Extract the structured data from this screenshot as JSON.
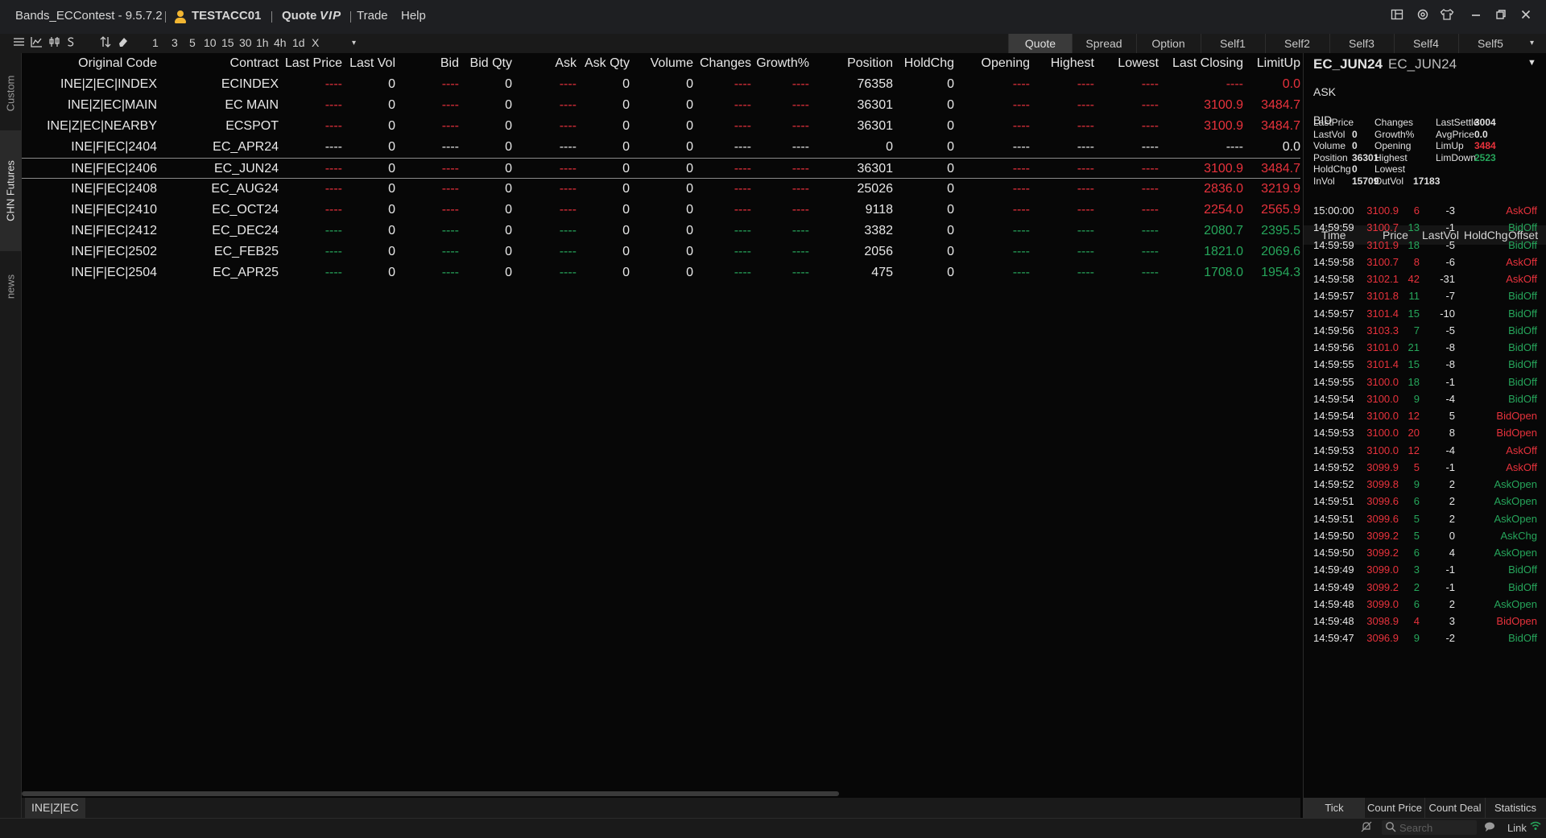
{
  "colors": {
    "up": "#e8323c",
    "down": "#26a65b",
    "accent": "#f2b632"
  },
  "titlebar": {
    "app_title": "Bands_ECContest - 9.5.7.2",
    "username": "TESTACC01",
    "menu": [
      "Quote",
      "VIP",
      "Trade",
      "Help"
    ]
  },
  "toolbar": {
    "periods": [
      "1",
      "3",
      "5",
      "10",
      "15",
      "30",
      "1h",
      "4h",
      "1d",
      "X"
    ],
    "tabs": [
      "Quote",
      "Spread",
      "Option",
      "Self1",
      "Self2",
      "Self3",
      "Self4",
      "Self5"
    ],
    "active_tab": "Quote"
  },
  "sidebar": {
    "tabs": [
      "Custom",
      "CHN Futures",
      "news"
    ],
    "active": "CHN Futures"
  },
  "table": {
    "columns": [
      "Original Code",
      "Contract",
      "Last Price",
      "Last Vol",
      "Bid",
      "Bid Qty",
      "Ask",
      "Ask Qty",
      "Volume",
      "Changes",
      "Growth%",
      "Position",
      "HoldChg",
      "Opening",
      "Highest",
      "Lowest",
      "Last Closing",
      "LimitUp"
    ],
    "rows": [
      {
        "code": "INE|Z|EC|INDEX",
        "contract": "ECINDEX",
        "last_price": "----",
        "last_vol": "0",
        "bid": "----",
        "bid_qty": "0",
        "ask": "----",
        "ask_qty": "0",
        "volume": "0",
        "changes": "----",
        "growth": "----",
        "position": "76358",
        "holdchg": "0",
        "opening": "----",
        "highest": "----",
        "lowest": "----",
        "last_closing": "----",
        "limitup": "0.0",
        "color": "red"
      },
      {
        "code": "INE|Z|EC|MAIN",
        "contract": "EC MAIN",
        "last_price": "----",
        "last_vol": "0",
        "bid": "----",
        "bid_qty": "0",
        "ask": "----",
        "ask_qty": "0",
        "volume": "0",
        "changes": "----",
        "growth": "----",
        "position": "36301",
        "holdchg": "0",
        "opening": "----",
        "highest": "----",
        "lowest": "----",
        "last_closing": "3100.9",
        "limitup": "3484.7",
        "color": "red"
      },
      {
        "code": "INE|Z|EC|NEARBY",
        "contract": "ECSPOT",
        "last_price": "----",
        "last_vol": "0",
        "bid": "----",
        "bid_qty": "0",
        "ask": "----",
        "ask_qty": "0",
        "volume": "0",
        "changes": "----",
        "growth": "----",
        "position": "36301",
        "holdchg": "0",
        "opening": "----",
        "highest": "----",
        "lowest": "----",
        "last_closing": "3100.9",
        "limitup": "3484.7",
        "color": "red"
      },
      {
        "code": "INE|F|EC|2404",
        "contract": "EC_APR24",
        "last_price": "----",
        "last_vol": "0",
        "bid": "----",
        "bid_qty": "0",
        "ask": "----",
        "ask_qty": "0",
        "volume": "0",
        "changes": "----",
        "growth": "----",
        "position": "0",
        "holdchg": "0",
        "opening": "----",
        "highest": "----",
        "lowest": "----",
        "last_closing": "----",
        "limitup": "0.0",
        "color": "white"
      },
      {
        "code": "INE|F|EC|2406",
        "contract": "EC_JUN24",
        "last_price": "----",
        "last_vol": "0",
        "bid": "----",
        "bid_qty": "0",
        "ask": "----",
        "ask_qty": "0",
        "volume": "0",
        "changes": "----",
        "growth": "----",
        "position": "36301",
        "holdchg": "0",
        "opening": "----",
        "highest": "----",
        "lowest": "----",
        "last_closing": "3100.9",
        "limitup": "3484.7",
        "color": "red",
        "selected": true
      },
      {
        "code": "INE|F|EC|2408",
        "contract": "EC_AUG24",
        "last_price": "----",
        "last_vol": "0",
        "bid": "----",
        "bid_qty": "0",
        "ask": "----",
        "ask_qty": "0",
        "volume": "0",
        "changes": "----",
        "growth": "----",
        "position": "25026",
        "holdchg": "0",
        "opening": "----",
        "highest": "----",
        "lowest": "----",
        "last_closing": "2836.0",
        "limitup": "3219.9",
        "color": "red"
      },
      {
        "code": "INE|F|EC|2410",
        "contract": "EC_OCT24",
        "last_price": "----",
        "last_vol": "0",
        "bid": "----",
        "bid_qty": "0",
        "ask": "----",
        "ask_qty": "0",
        "volume": "0",
        "changes": "----",
        "growth": "----",
        "position": "9118",
        "holdchg": "0",
        "opening": "----",
        "highest": "----",
        "lowest": "----",
        "last_closing": "2254.0",
        "limitup": "2565.9",
        "color": "red"
      },
      {
        "code": "INE|F|EC|2412",
        "contract": "EC_DEC24",
        "last_price": "----",
        "last_vol": "0",
        "bid": "----",
        "bid_qty": "0",
        "ask": "----",
        "ask_qty": "0",
        "volume": "0",
        "changes": "----",
        "growth": "----",
        "position": "3382",
        "holdchg": "0",
        "opening": "----",
        "highest": "----",
        "lowest": "----",
        "last_closing": "2080.7",
        "limitup": "2395.5",
        "color": "green"
      },
      {
        "code": "INE|F|EC|2502",
        "contract": "EC_FEB25",
        "last_price": "----",
        "last_vol": "0",
        "bid": "----",
        "bid_qty": "0",
        "ask": "----",
        "ask_qty": "0",
        "volume": "0",
        "changes": "----",
        "growth": "----",
        "position": "2056",
        "holdchg": "0",
        "opening": "----",
        "highest": "----",
        "lowest": "----",
        "last_closing": "1821.0",
        "limitup": "2069.6",
        "color": "green"
      },
      {
        "code": "INE|F|EC|2504",
        "contract": "EC_APR25",
        "last_price": "----",
        "last_vol": "0",
        "bid": "----",
        "bid_qty": "0",
        "ask": "----",
        "ask_qty": "0",
        "volume": "0",
        "changes": "----",
        "growth": "----",
        "position": "475",
        "holdchg": "0",
        "opening": "----",
        "highest": "----",
        "lowest": "----",
        "last_closing": "1708.0",
        "limitup": "1954.3",
        "color": "green"
      }
    ]
  },
  "bottom_tab": "INE|Z|EC",
  "detail": {
    "contract": "EC_JUN24",
    "contract_name": "EC_JUN24",
    "ask_label": "ASK",
    "bid_label": "BID",
    "stats": {
      "col1": [
        [
          "LastPrice",
          ""
        ],
        [
          "LastVol",
          "0"
        ],
        [
          "Volume",
          "0"
        ],
        [
          "Position",
          "36301"
        ],
        [
          "HoldChg",
          "0"
        ],
        [
          "InVol",
          "15709"
        ]
      ],
      "col2": [
        [
          "Changes",
          ""
        ],
        [
          "Growth%",
          ""
        ],
        [
          "Opening",
          ""
        ],
        [
          "Highest",
          ""
        ],
        [
          "Lowest",
          ""
        ],
        [
          "OutVol",
          "17183"
        ]
      ],
      "col3": [
        [
          "LastSettle",
          "3004"
        ],
        [
          "AvgPrice",
          "0.0"
        ],
        [
          "LimUp",
          "3484"
        ],
        [
          "LimDown",
          "2523"
        ]
      ]
    },
    "tick_columns": [
      "Time",
      "Price",
      "LastVol",
      "HoldChg",
      "Offset"
    ],
    "ticks": [
      {
        "time": "15:00:00",
        "price": "3100.9",
        "vol": "6",
        "hold": "-3",
        "offset": "AskOff",
        "pc": "red",
        "vc": "red",
        "oc": "red"
      },
      {
        "time": "14:59:59",
        "price": "3100.7",
        "vol": "13",
        "hold": "-1",
        "offset": "BidOff",
        "pc": "red",
        "vc": "green",
        "oc": "green"
      },
      {
        "time": "14:59:59",
        "price": "3101.9",
        "vol": "18",
        "hold": "-5",
        "offset": "BidOff",
        "pc": "red",
        "vc": "green",
        "oc": "green"
      },
      {
        "time": "14:59:58",
        "price": "3100.7",
        "vol": "8",
        "hold": "-6",
        "offset": "AskOff",
        "pc": "red",
        "vc": "red",
        "oc": "red"
      },
      {
        "time": "14:59:58",
        "price": "3102.1",
        "vol": "42",
        "hold": "-31",
        "offset": "AskOff",
        "pc": "red",
        "vc": "red",
        "oc": "red"
      },
      {
        "time": "14:59:57",
        "price": "3101.8",
        "vol": "11",
        "hold": "-7",
        "offset": "BidOff",
        "pc": "red",
        "vc": "green",
        "oc": "green"
      },
      {
        "time": "14:59:57",
        "price": "3101.4",
        "vol": "15",
        "hold": "-10",
        "offset": "BidOff",
        "pc": "red",
        "vc": "green",
        "oc": "green"
      },
      {
        "time": "14:59:56",
        "price": "3103.3",
        "vol": "7",
        "hold": "-5",
        "offset": "BidOff",
        "pc": "red",
        "vc": "green",
        "oc": "green"
      },
      {
        "time": "14:59:56",
        "price": "3101.0",
        "vol": "21",
        "hold": "-8",
        "offset": "BidOff",
        "pc": "red",
        "vc": "green",
        "oc": "green"
      },
      {
        "time": "14:59:55",
        "price": "3101.4",
        "vol": "15",
        "hold": "-8",
        "offset": "BidOff",
        "pc": "red",
        "vc": "green",
        "oc": "green"
      },
      {
        "time": "14:59:55",
        "price": "3100.0",
        "vol": "18",
        "hold": "-1",
        "offset": "BidOff",
        "pc": "red",
        "vc": "green",
        "oc": "green"
      },
      {
        "time": "14:59:54",
        "price": "3100.0",
        "vol": "9",
        "hold": "-4",
        "offset": "BidOff",
        "pc": "red",
        "vc": "green",
        "oc": "green"
      },
      {
        "time": "14:59:54",
        "price": "3100.0",
        "vol": "12",
        "hold": "5",
        "offset": "BidOpen",
        "pc": "red",
        "vc": "red",
        "oc": "red"
      },
      {
        "time": "14:59:53",
        "price": "3100.0",
        "vol": "20",
        "hold": "8",
        "offset": "BidOpen",
        "pc": "red",
        "vc": "red",
        "oc": "red"
      },
      {
        "time": "14:59:53",
        "price": "3100.0",
        "vol": "12",
        "hold": "-4",
        "offset": "AskOff",
        "pc": "red",
        "vc": "red",
        "oc": "red"
      },
      {
        "time": "14:59:52",
        "price": "3099.9",
        "vol": "5",
        "hold": "-1",
        "offset": "AskOff",
        "pc": "red",
        "vc": "red",
        "oc": "red"
      },
      {
        "time": "14:59:52",
        "price": "3099.8",
        "vol": "9",
        "hold": "2",
        "offset": "AskOpen",
        "pc": "red",
        "vc": "green",
        "oc": "green"
      },
      {
        "time": "14:59:51",
        "price": "3099.6",
        "vol": "6",
        "hold": "2",
        "offset": "AskOpen",
        "pc": "red",
        "vc": "green",
        "oc": "green"
      },
      {
        "time": "14:59:51",
        "price": "3099.6",
        "vol": "5",
        "hold": "2",
        "offset": "AskOpen",
        "pc": "red",
        "vc": "green",
        "oc": "green"
      },
      {
        "time": "14:59:50",
        "price": "3099.2",
        "vol": "5",
        "hold": "0",
        "offset": "AskChg",
        "pc": "red",
        "vc": "green",
        "oc": "green"
      },
      {
        "time": "14:59:50",
        "price": "3099.2",
        "vol": "6",
        "hold": "4",
        "offset": "AskOpen",
        "pc": "red",
        "vc": "green",
        "oc": "green"
      },
      {
        "time": "14:59:49",
        "price": "3099.0",
        "vol": "3",
        "hold": "-1",
        "offset": "BidOff",
        "pc": "red",
        "vc": "green",
        "oc": "green"
      },
      {
        "time": "14:59:49",
        "price": "3099.2",
        "vol": "2",
        "hold": "-1",
        "offset": "BidOff",
        "pc": "red",
        "vc": "green",
        "oc": "green"
      },
      {
        "time": "14:59:48",
        "price": "3099.0",
        "vol": "6",
        "hold": "2",
        "offset": "AskOpen",
        "pc": "red",
        "vc": "green",
        "oc": "green"
      },
      {
        "time": "14:59:48",
        "price": "3098.9",
        "vol": "4",
        "hold": "3",
        "offset": "BidOpen",
        "pc": "red",
        "vc": "red",
        "oc": "red"
      },
      {
        "time": "14:59:47",
        "price": "3096.9",
        "vol": "9",
        "hold": "-2",
        "offset": "BidOff",
        "pc": "red",
        "vc": "green",
        "oc": "green"
      }
    ],
    "tabs": [
      "Tick",
      "Count Price",
      "Count Deal",
      "Statistics"
    ]
  },
  "statusbar": {
    "search_placeholder": "Search",
    "link_label": "Link"
  }
}
